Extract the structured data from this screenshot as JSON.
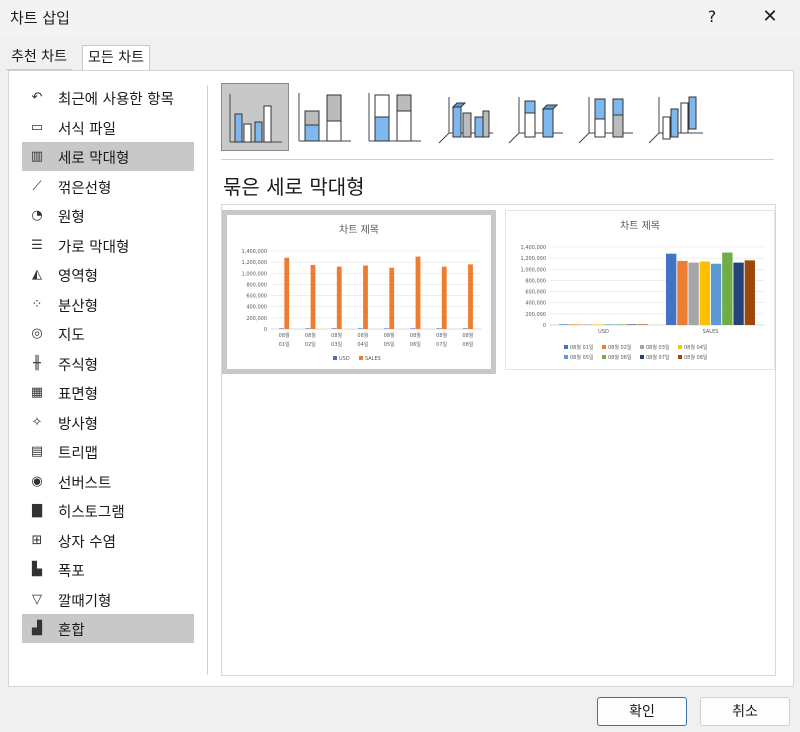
{
  "window": {
    "title": "차트 삽입",
    "help_label": "?",
    "close_label": "✕"
  },
  "tabs": [
    {
      "label": "추천 차트"
    },
    {
      "label": "모든 차트"
    }
  ],
  "chart_types": [
    {
      "label": "최근에 사용한 항목",
      "icon": "undo-icon"
    },
    {
      "label": "서식 파일",
      "icon": "folder-icon"
    },
    {
      "label": "세로 막대형",
      "icon": "column-chart-icon",
      "selected": true
    },
    {
      "label": "꺾은선형",
      "icon": "line-chart-icon"
    },
    {
      "label": "원형",
      "icon": "pie-chart-icon"
    },
    {
      "label": "가로 막대형",
      "icon": "bar-chart-icon"
    },
    {
      "label": "영역형",
      "icon": "area-chart-icon"
    },
    {
      "label": "분산형",
      "icon": "scatter-chart-icon"
    },
    {
      "label": "지도",
      "icon": "map-globe-icon"
    },
    {
      "label": "주식형",
      "icon": "stock-chart-icon"
    },
    {
      "label": "표면형",
      "icon": "surface-chart-icon"
    },
    {
      "label": "방사형",
      "icon": "radar-chart-icon"
    },
    {
      "label": "트리맵",
      "icon": "treemap-icon"
    },
    {
      "label": "선버스트",
      "icon": "sunburst-icon"
    },
    {
      "label": "히스토그램",
      "icon": "histogram-icon"
    },
    {
      "label": "상자 수염",
      "icon": "box-whisker-icon"
    },
    {
      "label": "폭포",
      "icon": "waterfall-icon"
    },
    {
      "label": "깔때기형",
      "icon": "funnel-icon"
    },
    {
      "label": "혼합",
      "icon": "combo-chart-icon",
      "selected": true
    }
  ],
  "subtype_heading": "묶은 세로 막대형",
  "colors": {
    "accent": "#3f6fb3",
    "orange": "#ed7d31",
    "blue": "#4472c4",
    "selection": "#c8c8c8"
  },
  "chart_data": [
    {
      "type": "bar",
      "title": "차트 제목",
      "categories": [
        [
          "08월",
          "01일"
        ],
        [
          "08월",
          "02일"
        ],
        [
          "08월",
          "03일"
        ],
        [
          "08월",
          "04일"
        ],
        [
          "08월",
          "05일"
        ],
        [
          "08월",
          "06일"
        ],
        [
          "08월",
          "07일"
        ],
        [
          "08월",
          "08일"
        ]
      ],
      "series": [
        {
          "name": "USD",
          "values": [
            0,
            0,
            0,
            0,
            0,
            0,
            0,
            0
          ],
          "color": "#4472c4"
        },
        {
          "name": "SALES",
          "values": [
            1280000,
            1150000,
            1120000,
            1140000,
            1100000,
            1300000,
            1120000,
            1160000
          ],
          "color": "#ed7d31"
        }
      ],
      "yticks": [
        "0",
        "200,000",
        "400,000",
        "600,000",
        "800,000",
        "1,000,000",
        "1,200,000",
        "1,400,000"
      ],
      "ylim": [
        0,
        1400000
      ],
      "legend": "bottom"
    },
    {
      "type": "bar",
      "title": "차트 제목",
      "categories": [
        "USD",
        "SALES"
      ],
      "series": [
        {
          "name": "08월 01일",
          "values": [
            0,
            1280000
          ],
          "color": "#4472c4"
        },
        {
          "name": "08월 02일",
          "values": [
            0,
            1150000
          ],
          "color": "#ed7d31"
        },
        {
          "name": "08월 03일",
          "values": [
            0,
            1120000
          ],
          "color": "#a5a5a5"
        },
        {
          "name": "08월 04일",
          "values": [
            0,
            1140000
          ],
          "color": "#ffc000"
        },
        {
          "name": "08월 05일",
          "values": [
            0,
            1100000
          ],
          "color": "#5b9bd5"
        },
        {
          "name": "08월 06일",
          "values": [
            0,
            1300000
          ],
          "color": "#70ad47"
        },
        {
          "name": "08월 07일",
          "values": [
            0,
            1120000
          ],
          "color": "#264478"
        },
        {
          "name": "08월 08일",
          "values": [
            0,
            1160000
          ],
          "color": "#9e480e"
        }
      ],
      "yticks": [
        "0",
        "200,000",
        "400,000",
        "600,000",
        "800,000",
        "1,000,000",
        "1,200,000",
        "1,400,000"
      ],
      "ylim": [
        0,
        1400000
      ],
      "legend": "bottom"
    }
  ],
  "buttons": {
    "ok": "확인",
    "cancel": "취소"
  }
}
